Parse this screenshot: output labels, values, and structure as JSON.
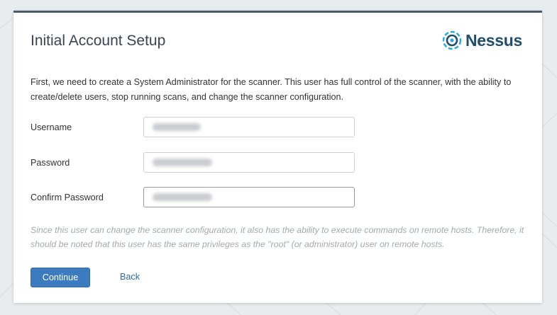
{
  "page": {
    "title": "Initial Account Setup",
    "logo_text": "Nessus",
    "intro": "First, we need to create a System Administrator for the scanner. This user has full control of the scanner, with the ability to create/delete users, stop running scans, and change the scanner configuration."
  },
  "form": {
    "username": {
      "label": "Username",
      "value": ""
    },
    "password": {
      "label": "Password",
      "value": ""
    },
    "confirm_password": {
      "label": "Confirm Password",
      "value": ""
    }
  },
  "note": "Since this user can change the scanner configuration, it also has the ability to execute commands on remote hosts. Therefore, it should be noted that this user has the same privileges as the \"root\" (or administrator) user on remote hosts.",
  "actions": {
    "continue_label": "Continue",
    "back_label": "Back"
  },
  "colors": {
    "primary_button": "#3c7bbd",
    "header_bar": "#4b5a68",
    "logo_text": "#1f4e70",
    "logo_accent": "#29a8df",
    "link": "#2d6ca2",
    "background": "#e9ecee"
  },
  "icons": {
    "logo": "nessus-logo-icon"
  }
}
